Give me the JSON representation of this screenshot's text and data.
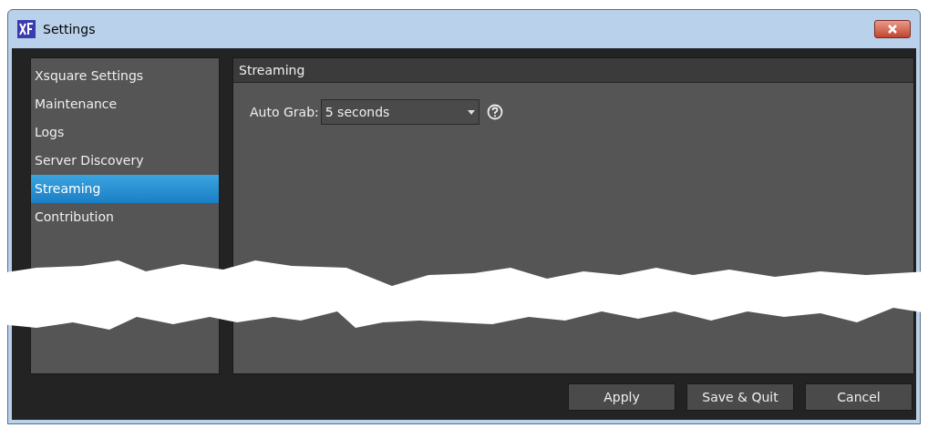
{
  "window": {
    "title": "Settings"
  },
  "sidebar": {
    "items": [
      {
        "label": "Xsquare Settings",
        "selected": false
      },
      {
        "label": "Maintenance",
        "selected": false
      },
      {
        "label": "Logs",
        "selected": false
      },
      {
        "label": "Server Discovery",
        "selected": false
      },
      {
        "label": "Streaming",
        "selected": true
      },
      {
        "label": "Contribution",
        "selected": false
      }
    ]
  },
  "panel": {
    "title": "Streaming",
    "fields": [
      {
        "label": "Auto Grab:",
        "value": "5 seconds"
      }
    ]
  },
  "buttons": [
    "Apply",
    "Save & Quit",
    "Cancel"
  ]
}
